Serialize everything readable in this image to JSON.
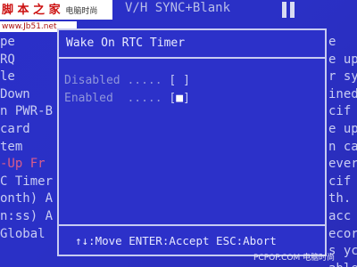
{
  "logo": {
    "text": "脚 本 之 家",
    "subtext": "电脑时尚"
  },
  "url": "www.Jb51.net",
  "top_text": "V/H SYNC+Blank",
  "bg_left_lines": [
    "pe",
    "RQ",
    "le",
    "Down",
    "n PWR-B",
    " card",
    "tem",
    "-Up Fr",
    "C Timer",
    "onth) A",
    "n:ss) A",
    "",
    "Global"
  ],
  "bg_right_lines": [
    "e",
    "e up",
    "r sy",
    "ined",
    "cif",
    "e up",
    "n ca",
    "ever",
    "cif",
    "th.",
    "acc",
    "ecor",
    "s yc",
    "able"
  ],
  "dialog": {
    "title": "Wake On RTC Timer",
    "options": [
      {
        "label": "Disabled",
        "dots": ".....",
        "mark": " "
      },
      {
        "label": "Enabled",
        "dots": ".....",
        "mark": "■"
      }
    ],
    "help": "↑↓:Move ENTER:Accept ESC:Abort"
  },
  "watermark": "PCPOP.COM 电脑时尚",
  "colors": {
    "background": "#2b2ec4",
    "text": "#c9cdf3",
    "border": "#c7cbf1",
    "highlight": "#d95d8b"
  }
}
